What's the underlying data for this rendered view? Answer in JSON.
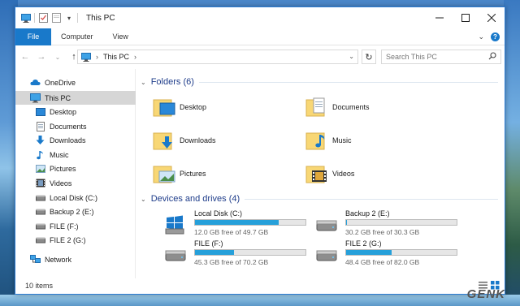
{
  "window": {
    "title": "This PC"
  },
  "ribbon": {
    "tabs": [
      "File",
      "Computer",
      "View"
    ]
  },
  "address": {
    "crumbs": [
      "This PC"
    ]
  },
  "search": {
    "placeholder": "Search This PC"
  },
  "nav": {
    "items": [
      {
        "label": "OneDrive",
        "icon": "cloud-icon"
      },
      {
        "label": "This PC",
        "icon": "computer-icon",
        "selected": true
      },
      {
        "label": "Desktop",
        "icon": "desktop-icon"
      },
      {
        "label": "Documents",
        "icon": "documents-icon"
      },
      {
        "label": "Downloads",
        "icon": "download-icon"
      },
      {
        "label": "Music",
        "icon": "music-icon"
      },
      {
        "label": "Pictures",
        "icon": "pictures-icon"
      },
      {
        "label": "Videos",
        "icon": "videos-icon"
      },
      {
        "label": "Local Disk (C:)",
        "icon": "drive-icon"
      },
      {
        "label": "Backup 2 (E:)",
        "icon": "drive-icon"
      },
      {
        "label": "FILE (F:)",
        "icon": "drive-icon"
      },
      {
        "label": "FILE 2 (G:)",
        "icon": "drive-icon"
      },
      {
        "label": "Network",
        "icon": "network-icon"
      }
    ]
  },
  "folders": {
    "header": "Folders (6)",
    "items": [
      {
        "label": "Desktop"
      },
      {
        "label": "Documents"
      },
      {
        "label": "Downloads"
      },
      {
        "label": "Music"
      },
      {
        "label": "Pictures"
      },
      {
        "label": "Videos"
      }
    ]
  },
  "devices": {
    "header": "Devices and drives (4)",
    "items": [
      {
        "label": "Local Disk (C:)",
        "free": "12.0 GB free of 49.7 GB",
        "used_fraction": 0.76
      },
      {
        "label": "Backup 2 (E:)",
        "free": "30.2 GB free of 30.3 GB",
        "used_fraction": 0.003
      },
      {
        "label": "FILE (F:)",
        "free": "45.3 GB free of 70.2 GB",
        "used_fraction": 0.355
      },
      {
        "label": "FILE 2 (G:)",
        "free": "48.4 GB free of 82.0 GB",
        "used_fraction": 0.41
      }
    ]
  },
  "status": {
    "count": "10 items"
  },
  "watermark": {
    "text": "GENK"
  },
  "colors": {
    "accent": "#1979ca",
    "bar_fill": "#26a0da",
    "group_header": "#1e3c8a",
    "folder_yellow": "#f8d775"
  }
}
